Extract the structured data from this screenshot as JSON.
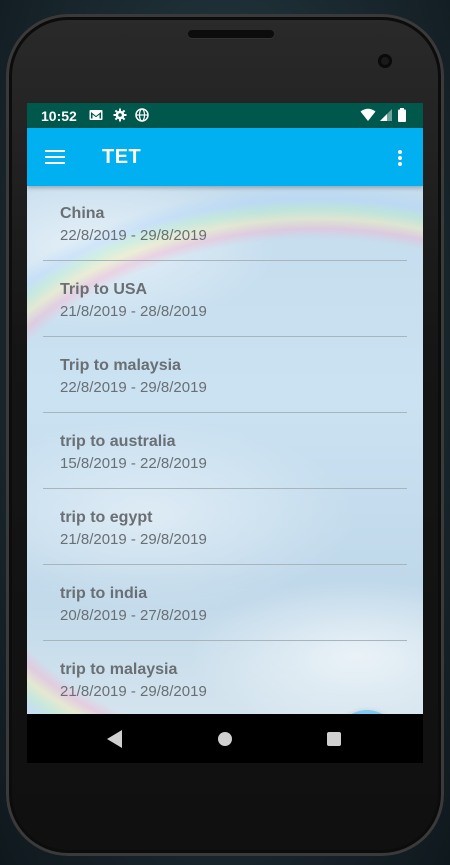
{
  "status_bar": {
    "time": "10:52",
    "icons": [
      "gmail-icon",
      "settings-icon",
      "globe-icon",
      "wifi-icon",
      "signal-icon",
      "battery-icon"
    ]
  },
  "toolbar": {
    "title": "TET",
    "menu_icon": "hamburger-menu-icon",
    "overflow_icon": "more-vert-icon"
  },
  "trips": [
    {
      "name": "China",
      "dates": "22/8/2019 - 29/8/2019"
    },
    {
      "name": "Trip to USA",
      "dates": "21/8/2019 - 28/8/2019"
    },
    {
      "name": "Trip to malaysia",
      "dates": "22/8/2019 - 29/8/2019"
    },
    {
      "name": "trip to australia",
      "dates": "15/8/2019 - 22/8/2019"
    },
    {
      "name": "trip to egypt",
      "dates": "21/8/2019 - 29/8/2019"
    },
    {
      "name": "trip to india",
      "dates": "20/8/2019 - 27/8/2019"
    },
    {
      "name": "trip to malaysia",
      "dates": "21/8/2019 - 29/8/2019"
    }
  ],
  "fab": {
    "icon": "add-icon"
  },
  "colors": {
    "status_bar": "#00574b",
    "toolbar": "#00b0f0",
    "fab": "#7fc8f8",
    "text": "#6a6f73"
  }
}
